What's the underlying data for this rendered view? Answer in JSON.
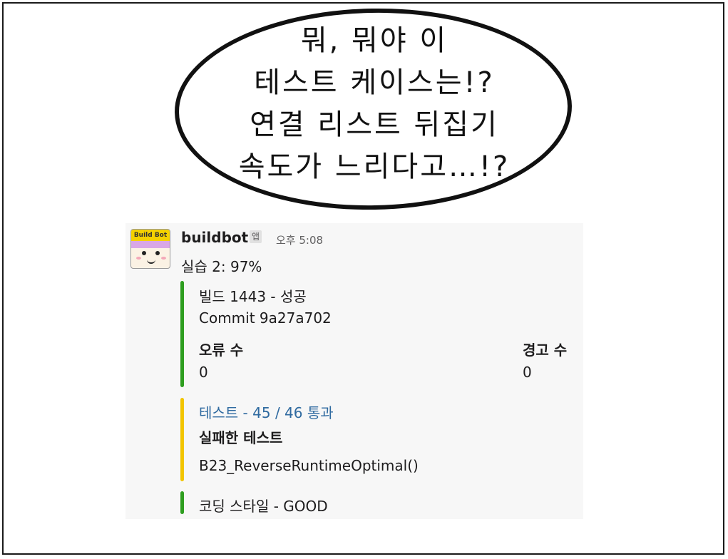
{
  "comic_bubble": {
    "lines": [
      "뭐, 뭐야 이",
      "테스트 케이스는!?",
      "연결 리스트 뒤집기",
      "속도가 느리다고…!?"
    ]
  },
  "message": {
    "avatar_label": "Build Bot",
    "username": "buildbot",
    "app_tag": "앱",
    "time": "오후 5:08",
    "text": "실습 2: 97%"
  },
  "attachments": [
    {
      "color": "#2e9e1f",
      "title": "빌드 1443 - 성공",
      "commit": "Commit 9a27a702",
      "fields": [
        {
          "label": "오류 수",
          "value": "0"
        },
        {
          "label": "경고 수",
          "value": "0"
        }
      ]
    },
    {
      "color": "#f2c500",
      "title": "테스트 - 45 / 46 통과",
      "title_color": "#2f6aa0",
      "failed_label": "실패한 테스트",
      "failed_test": "B23_ReverseRuntimeOptimal()"
    },
    {
      "color": "#2e9e1f",
      "title": "코딩 스타일 - GOOD"
    }
  ]
}
